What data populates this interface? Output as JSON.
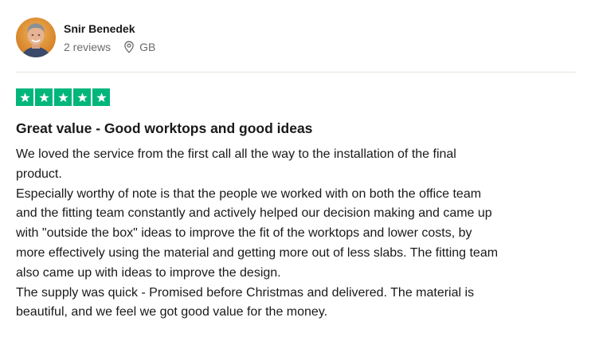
{
  "reviewer": {
    "name": "Snir Benedek",
    "reviews_count": "2 reviews",
    "country": "GB",
    "avatar_icon": "user-photo-avatar"
  },
  "rating": {
    "stars": 5,
    "max": 5,
    "color": "#00b67a",
    "icon": "star-icon"
  },
  "review": {
    "title": "Great value - Good worktops and good ideas",
    "body_lines": [
      "We loved the service from the first call all the way to the installation of the final",
      "product.",
      "Especially worthy of note is that the people we worked with on both the office team",
      "and the fitting team constantly and actively helped our decision making and came up",
      "with \"outside the box\" ideas to improve the fit of the worktops and lower costs, by",
      "more effectively using the material and getting more out of less slabs. The fitting team",
      "also came up with ideas to improve the design.",
      "The supply was quick - Promised before Christmas and delivered. The material is",
      "beautiful, and we feel we got good value for the money."
    ]
  },
  "icons": {
    "location": "location-pin-icon"
  }
}
